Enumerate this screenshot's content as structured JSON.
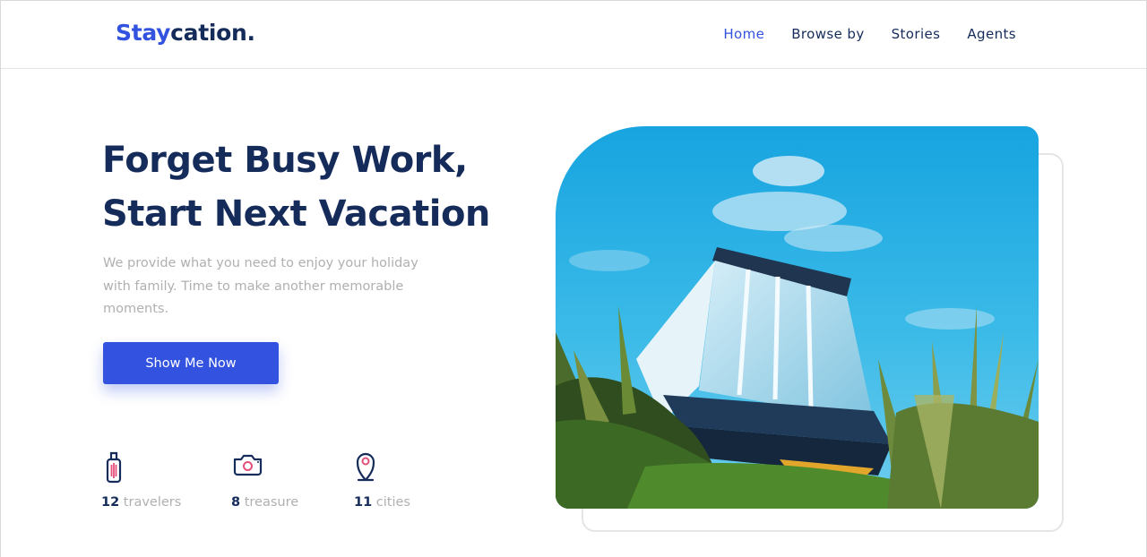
{
  "brand": {
    "part1": "Stay",
    "part2": "cation."
  },
  "nav": {
    "items": [
      {
        "label": "Home",
        "active": true
      },
      {
        "label": "Browse by",
        "active": false
      },
      {
        "label": "Stories",
        "active": false
      },
      {
        "label": "Agents",
        "active": false
      }
    ]
  },
  "hero": {
    "title_line1": "Forget Busy Work,",
    "title_line2": "Start Next Vacation",
    "description": "We provide what you need to enjoy your holiday with family. Time to make another memorable moments.",
    "cta_label": "Show Me Now"
  },
  "stats": [
    {
      "number": "12",
      "label": "travelers",
      "icon": "luggage-icon"
    },
    {
      "number": "8",
      "label": "treasure",
      "icon": "camera-icon"
    },
    {
      "number": "11",
      "label": "cities",
      "icon": "map-pin-icon"
    }
  ],
  "colors": {
    "primary": "#3252df",
    "navy": "#152c5b",
    "muted": "#b0b0b0",
    "accent_pink": "#e5507a"
  }
}
